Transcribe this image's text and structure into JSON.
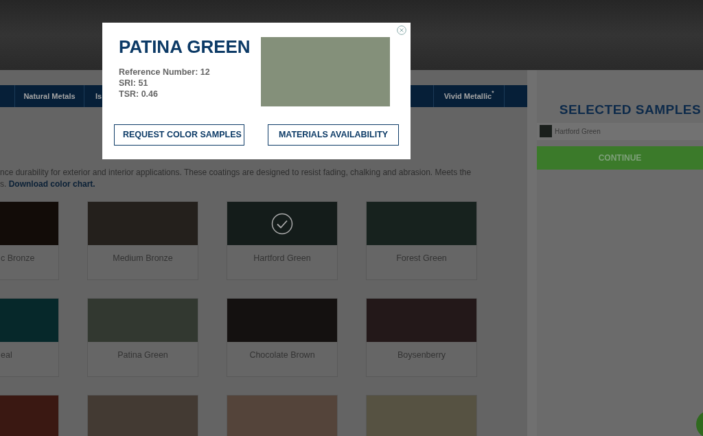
{
  "tabs": [
    {
      "label": "Natural Metals"
    },
    {
      "label": "Is"
    },
    {
      "label": "Vivid Metallic$^{*}$"
    }
  ],
  "description": {
    "text": "nce durability for exterior and interior applications. These coatings are designed to resist fading, chalking and abrasion. Meets the",
    "text_2": "s.",
    "link": "Download color chart."
  },
  "colors": [
    {
      "name": "c Bronze",
      "color": "#120c08",
      "selected": false
    },
    {
      "name": "Medium Bronze",
      "color": "#24201c",
      "selected": false
    },
    {
      "name": "Hartford Green",
      "color": "#141c1a",
      "selected": true
    },
    {
      "name": "Forest Green",
      "color": "#17221e",
      "selected": false
    },
    {
      "name": "eal",
      "color": "#06282a",
      "selected": false
    },
    {
      "name": "Patina Green",
      "color": "#323830",
      "selected": false
    },
    {
      "name": "Chocolate Brown",
      "color": "#141110",
      "selected": false
    },
    {
      "name": "Boysenberry",
      "color": "#231819",
      "selected": false
    },
    {
      "color": "#3a1812",
      "selected": false
    },
    {
      "color": "#433a33",
      "selected": false
    },
    {
      "color": "#54443a",
      "selected": false
    },
    {
      "color": "#565242",
      "selected": false
    }
  ],
  "selected_samples": {
    "title": "SELECTED SAMPLES",
    "items": [
      {
        "name": "Hartford Green",
        "color": "#1a1f1c"
      }
    ],
    "continue_button": "CONTINUE"
  },
  "modal": {
    "title": "PATINA GREEN",
    "specs": [
      "Reference Number: 12",
      "SRI: 51",
      "TSR: 0.46"
    ],
    "color": "#84907a",
    "buttons": [
      "REQUEST COLOR SAMPLES",
      "MATERIALS AVAILABILITY"
    ]
  }
}
